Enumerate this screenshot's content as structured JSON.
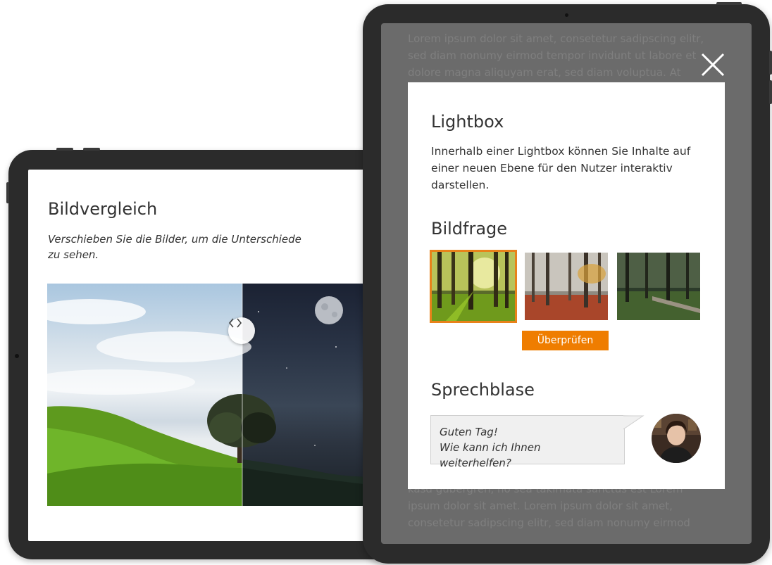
{
  "left_tablet": {
    "title": "Bildvergleich",
    "subtitle": "Verschieben Sie die Bilder, um die Unterschiede zu sehen."
  },
  "right_tablet": {
    "background_text_top": "Lorem ipsum dolor sit amet, consetetur sadipscing elitr, sed diam nonumy eirmod tempor invidunt ut labore et dolore magna aliquyam erat, sed diam voluptua. At",
    "background_text_bottom": "kasd gubergren, no sea takimata sanctus est Lorem ipsum dolor sit amet. Lorem ipsum dolor sit amet, consetetur sadipscing elitr, sed diam nonumy eirmod",
    "lightbox": {
      "title": "Lightbox",
      "text": "Innerhalb einer Lightbox können Sie Inhalte auf einer neuen Ebene für den Nutzer interaktiv darstellen.",
      "image_question_heading": "Bildfrage",
      "check_button": "Überprüfen",
      "speech_heading": "Sprechblase",
      "speech_line1": "Guten Tag!",
      "speech_line2": "Wie kann ich Ihnen weiterhelfen?"
    }
  },
  "colors": {
    "accent": "#ef7d00",
    "device": "#2b2b2b",
    "overlay": "#6b6b6b"
  },
  "icons": [
    "compare-handle-icon",
    "close-icon"
  ]
}
